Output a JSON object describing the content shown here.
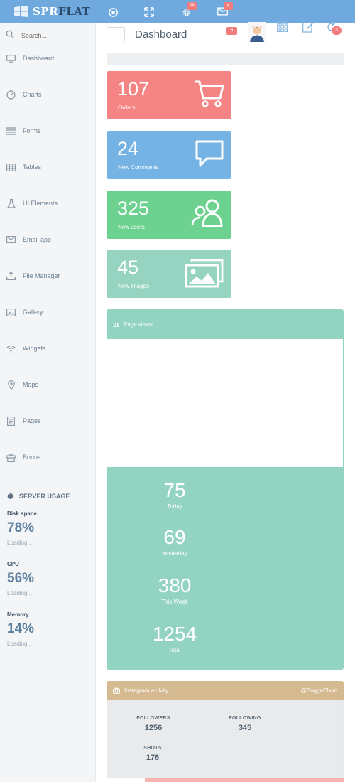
{
  "brand": {
    "logo_text_a": "SPR",
    "logo_text_b": "FLAT"
  },
  "topbar": {
    "settings_badge": "10",
    "mail_badge": "4"
  },
  "sidebar": {
    "search_placeholder": "Search...",
    "items": [
      {
        "label": "Dashboard",
        "icon": "monitor-icon"
      },
      {
        "label": "Charts",
        "icon": "gauge-icon"
      },
      {
        "label": "Forms",
        "icon": "list-icon"
      },
      {
        "label": "Tables",
        "icon": "table-icon"
      },
      {
        "label": "UI Elements",
        "icon": "flask-icon"
      },
      {
        "label": "Email app",
        "icon": "envelope-icon"
      },
      {
        "label": "File Manager",
        "icon": "upload-icon"
      },
      {
        "label": "Gallery",
        "icon": "image-icon"
      },
      {
        "label": "Widgets",
        "icon": "wifi-icon"
      },
      {
        "label": "Maps",
        "icon": "map-pin-icon"
      },
      {
        "label": "Pages",
        "icon": "pages-icon"
      },
      {
        "label": "Bonus",
        "icon": "gift-icon"
      }
    ],
    "server_usage": {
      "title": "SERVER USAGE",
      "metrics": [
        {
          "name": "Disk space",
          "value": "78%",
          "status": "Loading..."
        },
        {
          "name": "CPU",
          "value": "56%",
          "status": "Loading..."
        },
        {
          "name": "Memory",
          "value": "14%",
          "status": "Loading..."
        }
      ]
    }
  },
  "header": {
    "title": "Dashboard",
    "notif_badge": "5",
    "circle_badge": "3"
  },
  "tiles": [
    {
      "value": "107",
      "label": "Orders",
      "color": "#f58584",
      "icon": "cart-icon"
    },
    {
      "value": "24",
      "label": "New Comments",
      "color": "#74b3e3",
      "icon": "comment-icon"
    },
    {
      "value": "325",
      "label": "New users",
      "color": "#6dd18f",
      "icon": "users-icon"
    },
    {
      "value": "45",
      "label": "New images",
      "color": "#96d4c1",
      "icon": "images-icon"
    }
  ],
  "page_views": {
    "title": "Page views",
    "stats": [
      {
        "value": "75",
        "label": "Today"
      },
      {
        "value": "69",
        "label": "Yesterday"
      },
      {
        "value": "380",
        "label": "This Week"
      },
      {
        "value": "1254",
        "label": "Total"
      }
    ]
  },
  "instagram": {
    "title": "Instagram activity",
    "user": "@SuggeElson",
    "stats": [
      {
        "label": "FOLLOWERS",
        "value": "1256"
      },
      {
        "label": "FOLLOWING",
        "value": "345"
      },
      {
        "label": "SHOTS",
        "value": "176"
      }
    ]
  },
  "colors": {
    "topbar": "#6fa9dd",
    "sidebar_bg": "#f3f5f7",
    "page_views_panel": "#93d3c2",
    "instagram_header": "#d5b990",
    "badge_red": "#f27b7b"
  }
}
